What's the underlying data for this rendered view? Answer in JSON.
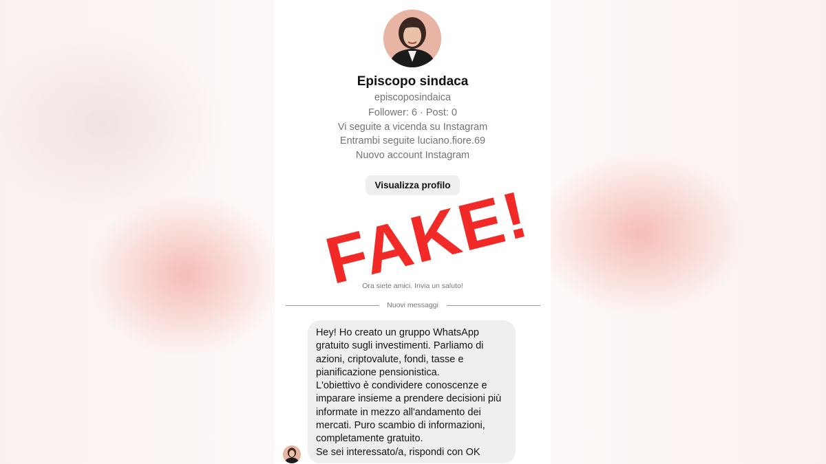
{
  "profile": {
    "name": "Episcopo sindaca",
    "username": "episcoposindaica",
    "stats": "Follower: 6 · Post: 0",
    "mutual_follow": "Vi seguite a vicenda su Instagram",
    "mutual_accounts": "Entrambi seguite luciano.fiore.69",
    "account_note": "Nuovo account Instagram",
    "view_profile_label": "Visualizza profilo"
  },
  "chat": {
    "friends_note": "Ora siete amici. Invia un saluto!",
    "new_messages_label": "Nuovi messaggi",
    "message_paragraphs": [
      "Hey! Ho creato un gruppo WhatsApp gratuito sugli investimenti. Parliamo di azioni, criptovalute, fondi, tasse e pianificazione pensionistica.",
      "L'obiettivo è condividere conoscenze e imparare insieme a prendere decisioni più informate in mezzo all'andamento dei mercati. Puro scambio di informazioni, completamente gratuito.",
      "Se sei interessato/a, rispondi con OK"
    ]
  },
  "overlay": {
    "stamp_text": "FAKE!"
  },
  "colors": {
    "stamp": "#f12a28",
    "bubble": "#efefef",
    "button": "#efefef",
    "secondary_text": "#737373"
  },
  "icons": {
    "avatar": "profile-photo",
    "small_avatar": "profile-photo-small"
  }
}
